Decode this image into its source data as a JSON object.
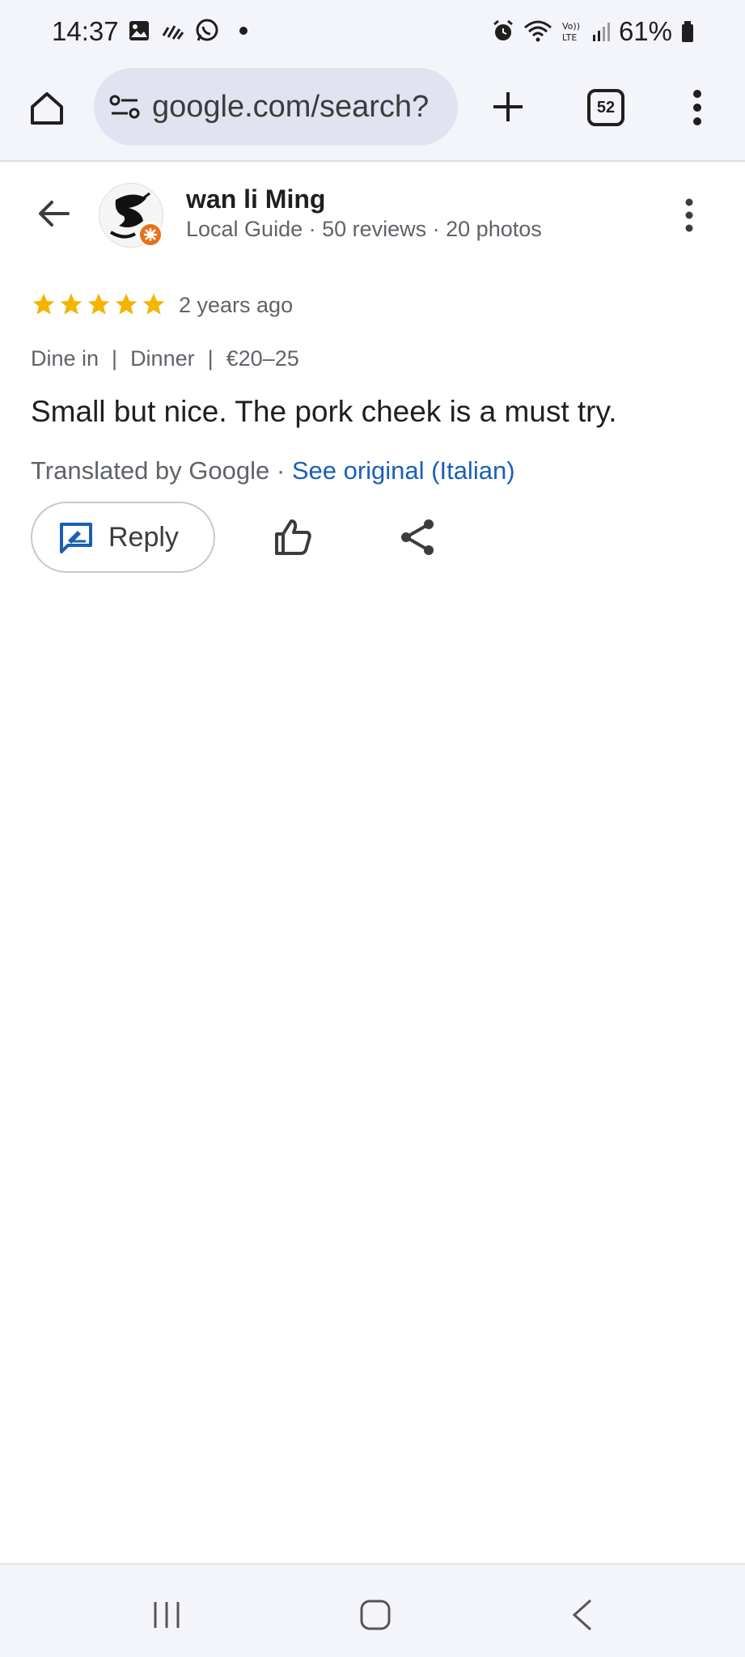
{
  "status_bar": {
    "time": "14:37",
    "battery": "61%",
    "icons": [
      "gallery-icon",
      "signal-bars-icon",
      "whatsapp-icon",
      "alarm-icon",
      "wifi-icon",
      "volte-icon",
      "cell-signal-icon",
      "battery-icon"
    ]
  },
  "browser": {
    "url": "google.com/search?",
    "tab_count": "52"
  },
  "review": {
    "author_name": "wan li Ming",
    "author_meta": "Local Guide · 50 reviews · 20 photos",
    "rating": 5,
    "time_ago": "2 years ago",
    "tags": [
      "Dine in",
      "Dinner",
      "€20–25"
    ],
    "tag_separator": "|",
    "text": "Small but nice. The pork cheek is a must try.",
    "translated_by": "Translated by Google ·",
    "see_original": "See original (Italian)"
  },
  "actions": {
    "reply_label": "Reply"
  },
  "colors": {
    "star": "#f4b400",
    "link": "#1a5fb4",
    "guide_badge": "#e8711a"
  }
}
